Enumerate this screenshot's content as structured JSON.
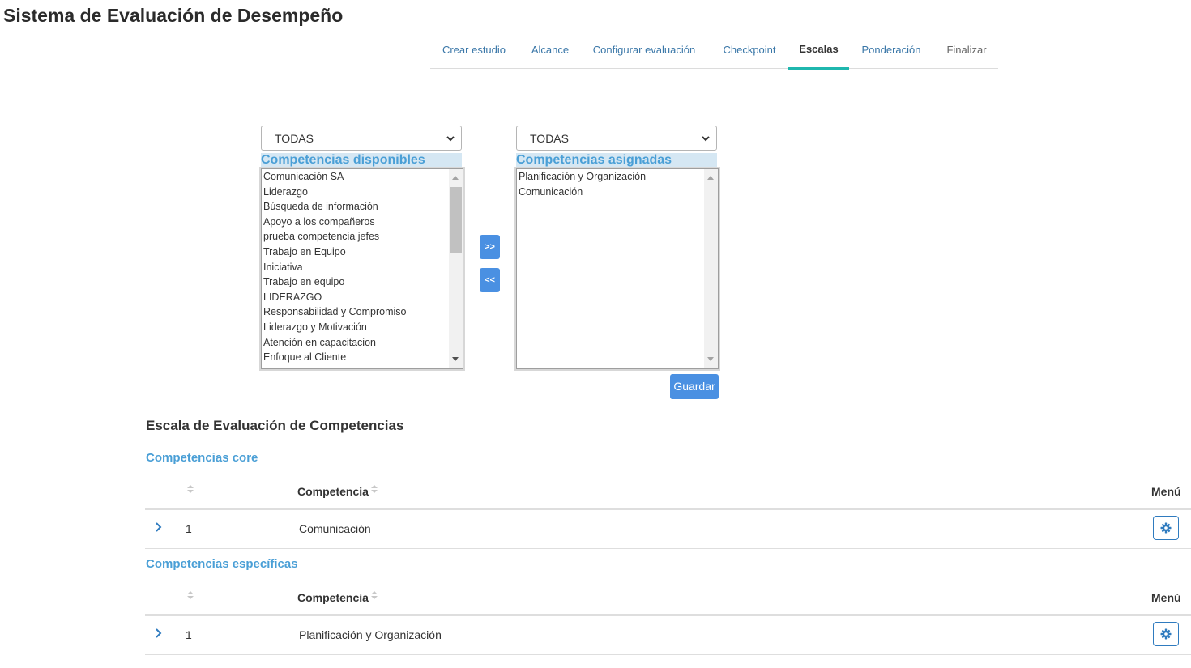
{
  "app": {
    "title": "Sistema de Evaluación de Desempeño"
  },
  "tabs": [
    {
      "label": "Crear estudio"
    },
    {
      "label": "Alcance"
    },
    {
      "label": "Configurar evaluación"
    },
    {
      "label": "Checkpoint"
    },
    {
      "label": "Escalas",
      "active": true
    },
    {
      "label": "Ponderación"
    },
    {
      "label": "Finalizar"
    }
  ],
  "available": {
    "filter_value": "TODAS",
    "header": "Competencias disponibles",
    "items": [
      "Comunicación SA",
      "Liderazgo",
      "Búsqueda de información",
      "Apoyo a los compañeros",
      "prueba competencia jefes",
      "Trabajo en Equipo",
      "Iniciativa",
      "Trabajo en equipo",
      "LIDERAZGO",
      "Responsabilidad y Compromiso",
      "Liderazgo y Motivación",
      "Atención en capacitacion",
      "Enfoque al Cliente"
    ]
  },
  "assigned": {
    "filter_value": "TODAS",
    "header": "Competencias asignadas",
    "items": [
      "Planificación y Organización",
      "Comunicación"
    ]
  },
  "actions": {
    "add_label": ">>",
    "remove_label": "<<",
    "save_label": "Guardar"
  },
  "scale": {
    "title": "Escala de Evaluación de Competencias",
    "core": {
      "title": "Competencias core",
      "col_competencia": "Competencia",
      "col_menu": "Menú",
      "rows": [
        {
          "num": "1",
          "competencia": "Comunicación"
        }
      ]
    },
    "specific": {
      "title": "Competencias específicas",
      "col_competencia": "Competencia",
      "col_menu": "Menú",
      "rows": [
        {
          "num": "1",
          "competencia": "Planificación y Organización"
        }
      ]
    }
  },
  "icons": {
    "chevron": "chevron-down-icon",
    "expand": "chevron-right-icon",
    "sort": "sort-icon",
    "menu": "gear-icon"
  },
  "colors": {
    "accent": "#4a90e2",
    "tab_active_underline": "#1fb7ae",
    "header_text": "#4a9fd6",
    "header_bg": "#d5e7f3"
  }
}
